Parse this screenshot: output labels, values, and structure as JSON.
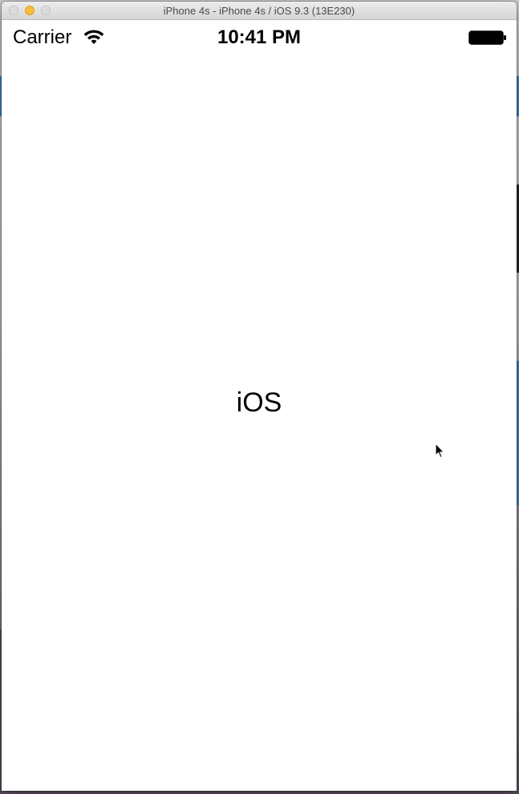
{
  "window": {
    "title": "iPhone 4s - iPhone 4s / iOS 9.3 (13E230)"
  },
  "status_bar": {
    "carrier": "Carrier",
    "time": "10:41 PM",
    "wifi_icon": "wifi-icon",
    "battery_icon": "battery-icon"
  },
  "main": {
    "label": "iOS"
  },
  "colors": {
    "screen_background": "#ffffff",
    "text": "#000000",
    "minimize_button": "#f6bd3b"
  }
}
